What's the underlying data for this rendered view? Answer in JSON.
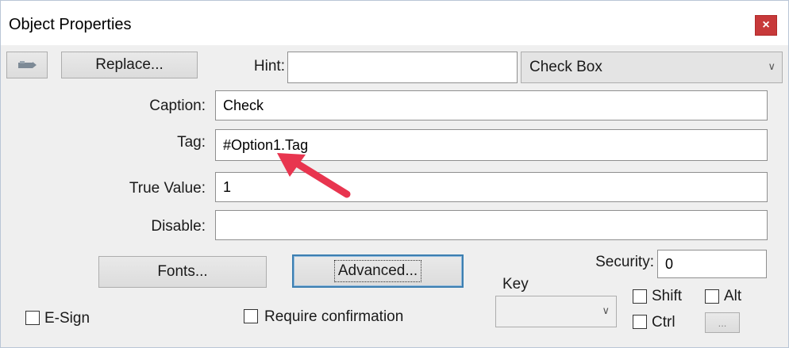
{
  "window": {
    "title": "Object Properties",
    "close_label": "×"
  },
  "toolbar": {
    "replace_label": "Replace...",
    "hint_label": "Hint:",
    "hint_value": "",
    "object_type": "Check Box"
  },
  "fields": {
    "caption_label": "Caption:",
    "caption_value": "Check",
    "tag_label": "Tag:",
    "tag_value": "#Option1.Tag",
    "true_value_label": "True Value:",
    "true_value_value": "1",
    "disable_label": "Disable:",
    "disable_value": ""
  },
  "buttons": {
    "fonts_label": "Fonts...",
    "advanced_label": "Advanced...",
    "small_label": "..."
  },
  "security": {
    "label": "Security:",
    "value": "0"
  },
  "key": {
    "label": "Key",
    "value": ""
  },
  "modifiers": {
    "shift_label": "Shift",
    "alt_label": "Alt",
    "ctrl_label": "Ctrl"
  },
  "options": {
    "esign_label": "E-Sign",
    "require_confirmation_label": "Require confirmation"
  },
  "colors": {
    "close": "#c7393a",
    "arrow": "#e8354f",
    "focus": "#3c7fb1"
  }
}
